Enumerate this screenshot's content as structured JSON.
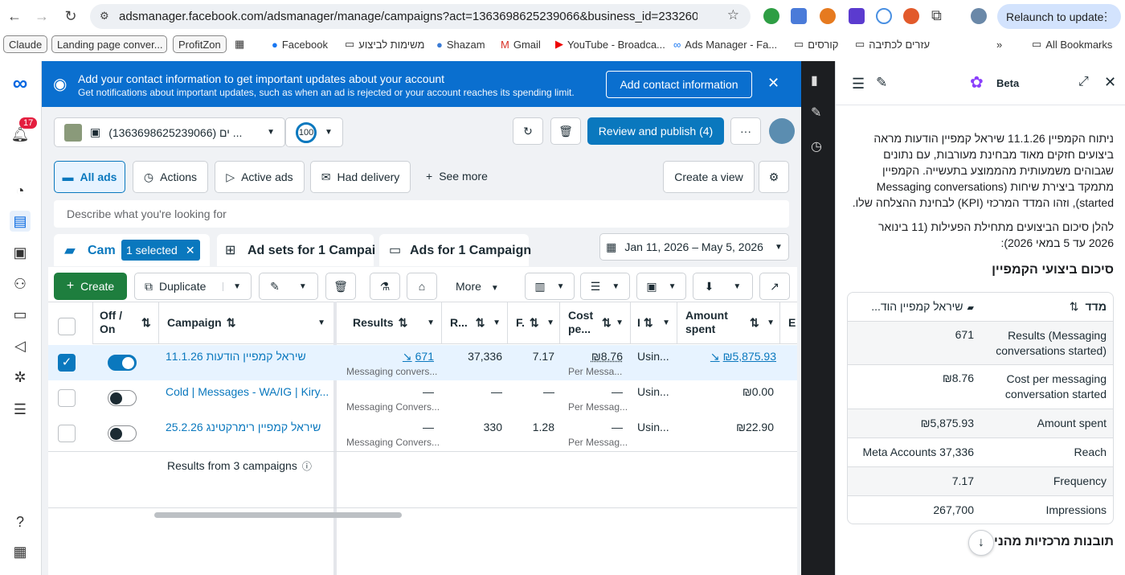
{
  "browser": {
    "url": "adsmanager.facebook.com/adsmanager/manage/campaigns?act=1363698625239066&business_id=2332607562...",
    "relaunch": "Relaunch to update",
    "bookmarks": [
      "Claude",
      "Landing page conver...",
      "ProfitZon",
      "Facebook",
      "משימות לביצוע",
      "Shazam",
      "Gmail",
      "YouTube - Broadca...",
      "Ads Manager - Fa...",
      "קורסים",
      "עזרים לכתיבה",
      "All Bookmarks"
    ]
  },
  "rail": {
    "notifications": "17"
  },
  "banner": {
    "title": "Add your contact information to get important updates about your account",
    "subtitle": "Get notifications about important updates, such as when an ad is rejected or your account reaches its spending limit.",
    "button": "Add contact information"
  },
  "account": {
    "name": "(1363698625239066) ים ...",
    "score": "100",
    "review": "Review and publish (4)"
  },
  "views": {
    "all_ads": "All ads",
    "actions": "Actions",
    "active_ads": "Active ads",
    "had_delivery": "Had delivery",
    "see_more": "See more",
    "create_view": "Create a view"
  },
  "search": {
    "placeholder": "Describe what you're looking for"
  },
  "tabs": {
    "campaigns": "Cam",
    "selected": "1 selected",
    "adsets": "Ad sets for 1 Campai",
    "ads": "Ads for 1 Campaign",
    "daterange": "Jan 11, 2026 – May 5, 2026"
  },
  "toolbar": {
    "create": "Create",
    "duplicate": "Duplicate",
    "more": "More"
  },
  "columns": {
    "offon": "Off / On",
    "campaign": "Campaign",
    "results": "Results",
    "reach": "R...",
    "frequency": "F.",
    "cost": "Cost pe...",
    "bid": "I",
    "amount": "Amount spent",
    "e": "E"
  },
  "rows": [
    {
      "name": "שיראל קמפיין הודעות 11.1.26",
      "results": "671",
      "results_sub": "Messaging convers...",
      "reach": "37,336",
      "freq": "7.17",
      "cost": "₪8.76",
      "cost_sub": "Per Messa...",
      "bid": "Usin...",
      "amount": "₪5,875.93",
      "on": true,
      "checked": true
    },
    {
      "name": "Cold | Messages - WA/IG | Kiry...",
      "results": "—",
      "results_sub": "Messaging Convers...",
      "reach": "—",
      "freq": "—",
      "cost": "—",
      "cost_sub": "Per Messag...",
      "bid": "Usin...",
      "amount": "₪0.00",
      "on": false,
      "checked": false
    },
    {
      "name": "שיראל קמפיין רימרקטינג 25.2.26",
      "results": "—",
      "results_sub": "Messaging Convers...",
      "reach": "330",
      "freq": "1.28",
      "cost": "—",
      "cost_sub": "Per Messag...",
      "bid": "Usin...",
      "amount": "₪22.90",
      "on": false,
      "checked": false
    }
  ],
  "footer": {
    "results_from": "Results from 3 campaigns"
  },
  "panel": {
    "beta": "Beta",
    "intro": "ניתוח הקמפיין 11.1.26 שיראל קמפיין הודעות מראה ביצועים חזקים מאוד מבחינת מעורבות, עם נתונים שגבוהים משמעותית מהממוצע בתעשייה. הקמפיין מתמקד ביצירת שיחות (Messaging conversations started), וזהו המדד המרכזי (KPI) לבחינת ההצלחה שלו.",
    "summary_intro": "להלן סיכום הביצועים מתחילת הפעילות (11 בינואר 2026 עד 5 במאי 2026):",
    "heading": "סיכום ביצועי הקמפיין",
    "table_metric": "מדד",
    "table_campaign": "שיראל קמפיין הוד...",
    "metrics": [
      {
        "label": "Results (Messaging conversations started)",
        "value": "671"
      },
      {
        "label": "Cost per messaging conversation started",
        "value": "₪8.76"
      },
      {
        "label": "Amount spent",
        "value": "₪5,875.93"
      },
      {
        "label": "Reach",
        "value": "Meta Accounts 37,336"
      },
      {
        "label": "Frequency",
        "value": "7.17"
      },
      {
        "label": "Impressions",
        "value": "267,700"
      }
    ],
    "heading2": "תובנות מרכזיות מהני"
  }
}
